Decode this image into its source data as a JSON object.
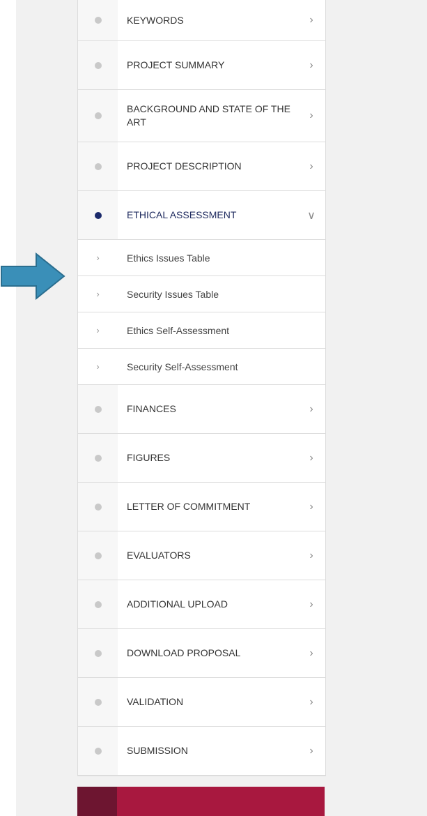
{
  "nav": {
    "items_before": [
      {
        "label": "KEYWORDS",
        "chevron": "chevron-right-icon"
      },
      {
        "label": "PROJECT SUMMARY",
        "chevron": "chevron-right-icon"
      },
      {
        "label": "BACKGROUND AND STATE OF THE ART",
        "chevron": "chevron-right-icon"
      },
      {
        "label": "PROJECT DESCRIPTION",
        "chevron": "chevron-right-icon"
      }
    ],
    "active": {
      "label": "ETHICAL ASSESSMENT",
      "chevron": "chevron-down-icon"
    },
    "sub_items": [
      {
        "label": "Ethics Issues Table"
      },
      {
        "label": "Security Issues Table"
      },
      {
        "label": "Ethics Self-Assessment"
      },
      {
        "label": "Security Self-Assessment"
      }
    ],
    "items_after": [
      {
        "label": "FINANCES"
      },
      {
        "label": "FIGURES"
      },
      {
        "label": "LETTER OF COMMITMENT"
      },
      {
        "label": "EVALUATORS"
      },
      {
        "label": "ADDITIONAL UPLOAD"
      },
      {
        "label": "DOWNLOAD PROPOSAL"
      },
      {
        "label": "VALIDATION"
      },
      {
        "label": "SUBMISSION"
      }
    ]
  },
  "colors": {
    "active_dot": "#1b2a6b",
    "inactive_dot": "#c9c9c9",
    "arrow": "#3a8fb8",
    "bottom_bar": "#a8183f"
  },
  "annotation": {
    "icon": "arrow-right-icon"
  }
}
